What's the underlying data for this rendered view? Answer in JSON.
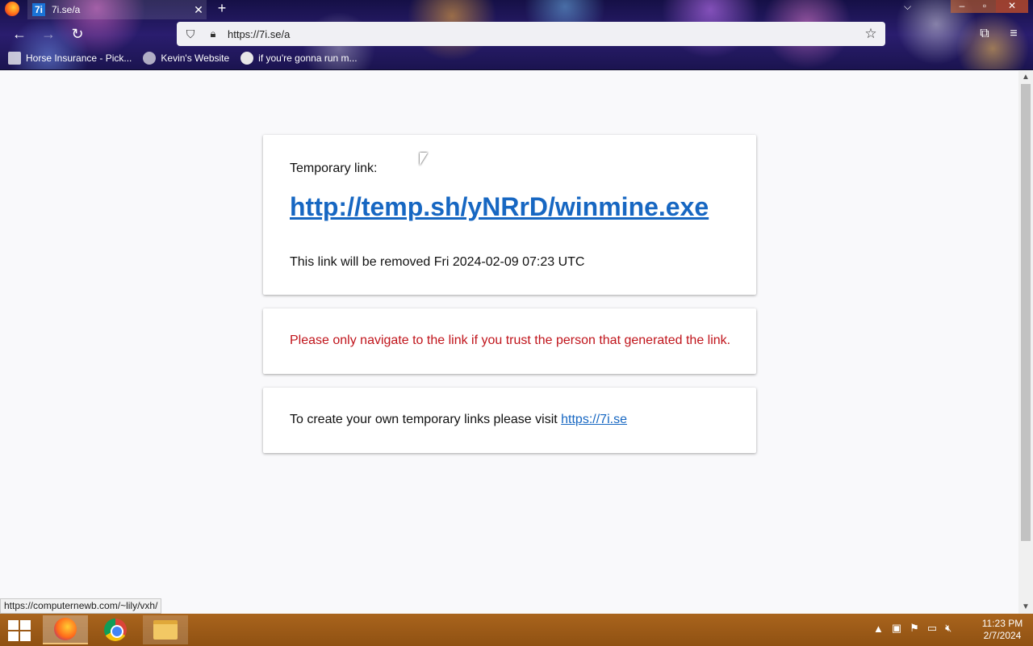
{
  "browser": {
    "tab_title": "7i.se/a",
    "tab_favicon": "7i",
    "url": "https://7i.se/a",
    "bookmarks": [
      {
        "label": "Horse Insurance - Pick..."
      },
      {
        "label": "Kevin's Website"
      },
      {
        "label": "if you're gonna run m..."
      }
    ]
  },
  "page": {
    "temp_label": "Temporary link:",
    "temp_link": "http://temp.sh/yNRrD/winmine.exe",
    "expiry": "This link will be removed Fri 2024-02-09 07:23 UTC",
    "warning": "Please only navigate to the link if you trust the person that generated the link.",
    "create_text": "To create your own temporary links please visit ",
    "create_link": "https://7i.se"
  },
  "status_bar": "https://computernewb.com/~lily/vxh/",
  "taskbar": {
    "time": "11:23 PM",
    "date": "2/7/2024"
  },
  "colors": {
    "link": "#1767c2",
    "warning": "#c0141b",
    "taskbar": "#a9641d"
  }
}
